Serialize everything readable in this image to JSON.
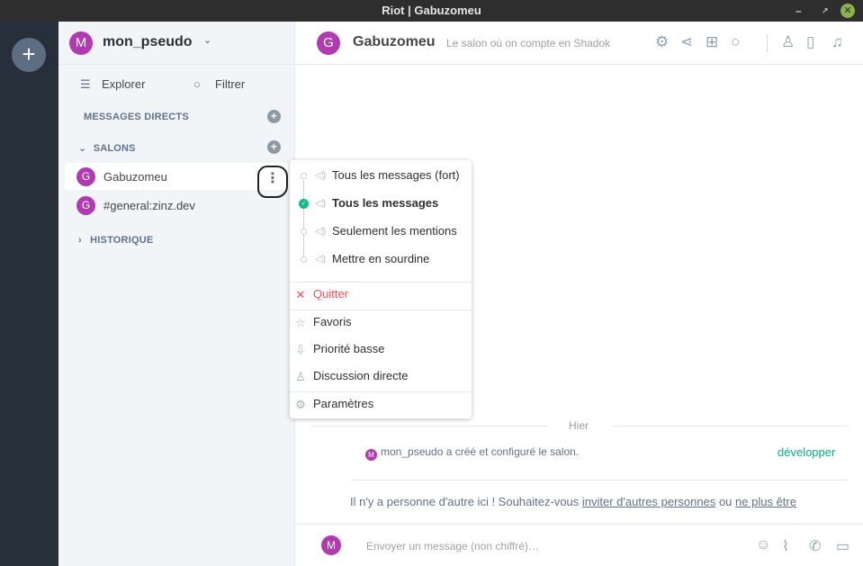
{
  "window": {
    "title": "Riot | Gabuzomeu",
    "controls": {
      "minimize": "–",
      "maximize": "↗",
      "close": "✕"
    }
  },
  "rail": {
    "add_label": "+"
  },
  "user": {
    "initial": "M",
    "name": "mon_pseudo",
    "chevron": "⌄"
  },
  "nav": {
    "explore_label": "Explorer",
    "explore_icon": "☰",
    "filter_label": "Filtrer",
    "filter_icon": "○"
  },
  "sections": {
    "dm": "MESSAGES DIRECTS",
    "rooms": "SALONS",
    "history": "HISTORIQUE",
    "collapse_icon": "⌄",
    "expand_icon": "›",
    "plus": "+"
  },
  "rooms": [
    {
      "initial": "G",
      "name": "Gabuzomeu",
      "menu": "⋮"
    },
    {
      "initial": "G",
      "name": "#general:zinz.dev"
    }
  ],
  "header": {
    "initial": "G",
    "title": "Gabuzomeu",
    "topic": "Le salon où on compte en Shadok",
    "icons": [
      "gear-icon",
      "share-icon",
      "apps-icon",
      "search-icon",
      "people-icon",
      "files-icon",
      "bell-icon"
    ]
  },
  "timeline": {
    "day": "Hier",
    "event_initial": "M",
    "event_text": "mon_pseudo a créé et configuré le salon.",
    "expand": "développer",
    "invite_prefix": "Il n'y a personne d'autre ici ! Souhaitez-vous ",
    "invite_link": "inviter d'autres personnes",
    "invite_mid": " ou ",
    "invite_link2": "ne plus être"
  },
  "composer": {
    "initial": "M",
    "placeholder": "Envoyer un message (non chiffré)…",
    "icons": [
      "emoji-icon",
      "attachment-icon",
      "phone-icon",
      "video-icon"
    ]
  },
  "context_menu": {
    "notifications": [
      {
        "label": "Tous les messages (fort)",
        "selected": false
      },
      {
        "label": "Tous les messages",
        "selected": true
      },
      {
        "label": "Seulement les mentions",
        "selected": false
      },
      {
        "label": "Mettre en sourdine",
        "selected": false
      }
    ],
    "check": "✓",
    "speaker": "◁)",
    "leave": {
      "icon": "✕",
      "label": "Quitter"
    },
    "favourite": {
      "icon": "☆",
      "label": "Favoris"
    },
    "low_priority": {
      "icon": "⇩",
      "label": "Priorité basse"
    },
    "direct_chat": {
      "icon": "♙",
      "label": "Discussion directe"
    },
    "settings": {
      "icon": "⚙",
      "label": "Paramètres"
    }
  },
  "colors": {
    "accent": "#0dbd8b",
    "avatar": "#b13ab3",
    "rail": "#27303a",
    "danger": "#ff4b55"
  }
}
